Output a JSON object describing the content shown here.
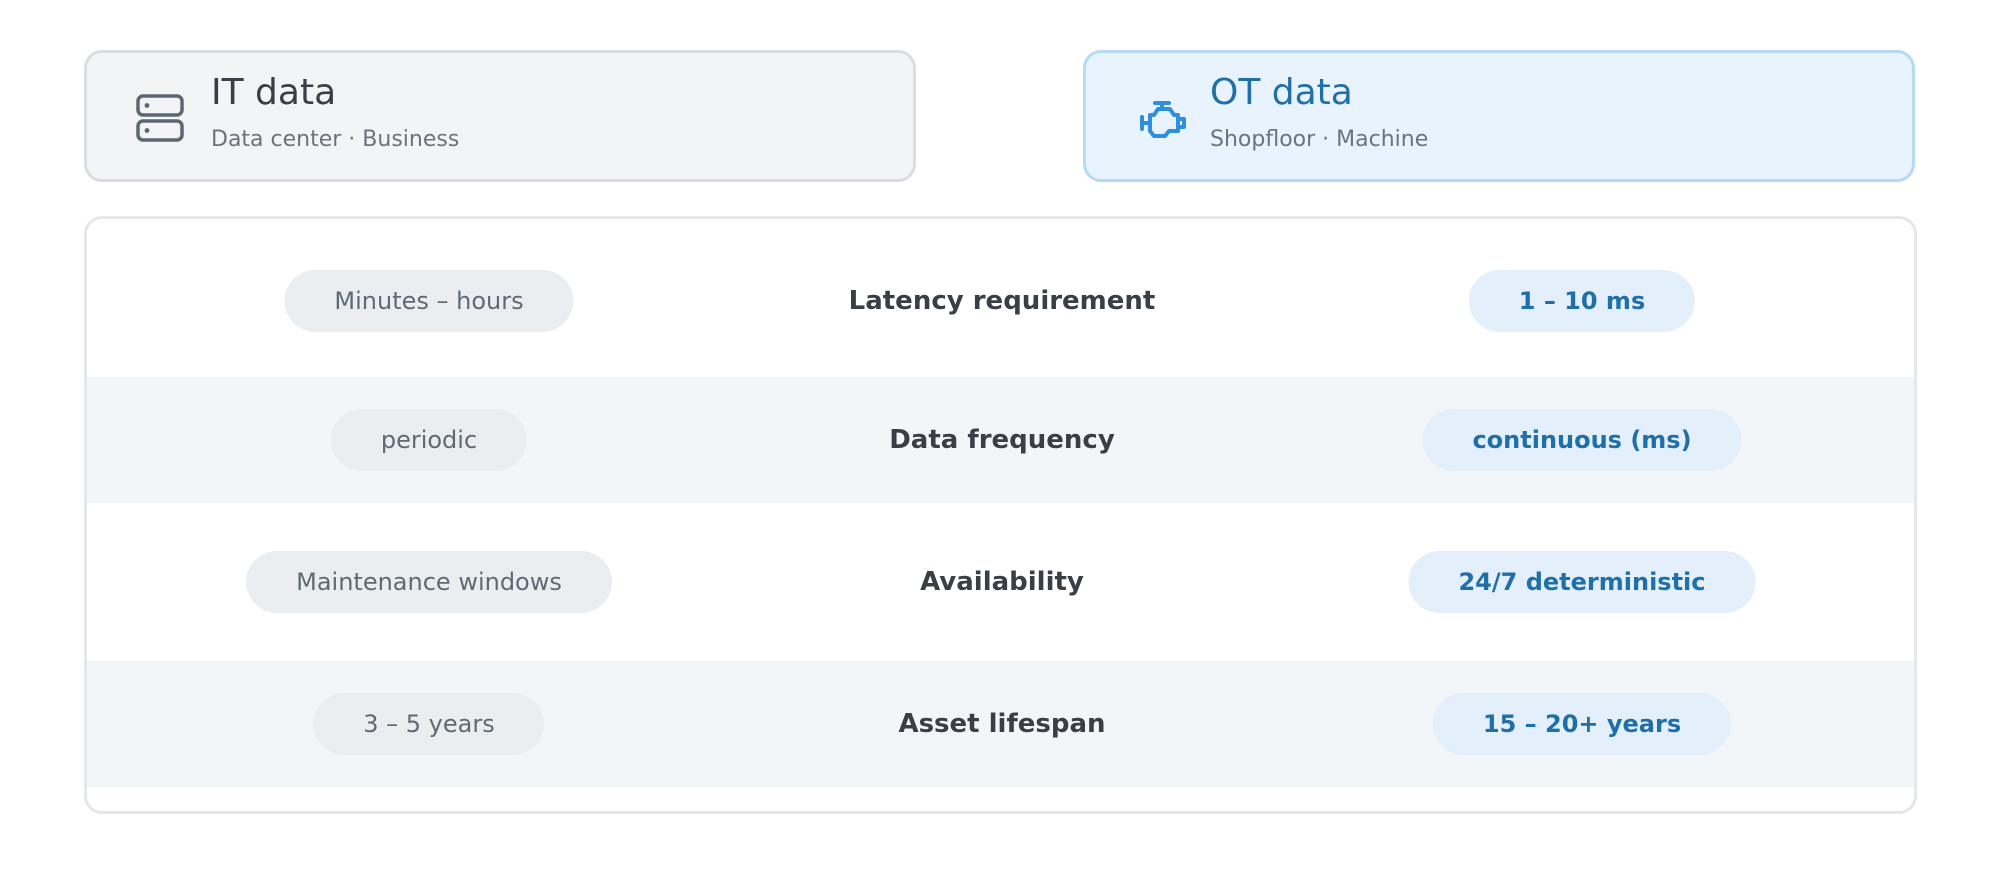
{
  "cards": {
    "it": {
      "title": "IT data",
      "subtitle": "Data center · Business",
      "icon": "server-icon",
      "color": "#5c6773"
    },
    "ot": {
      "title": "OT data",
      "subtitle": "Shopfloor · Machine",
      "icon": "engine-icon",
      "color": "#2e8fe0"
    }
  },
  "rows": [
    {
      "it": "Minutes – hours",
      "label": "Latency requirement",
      "ot": "1 – 10 ms"
    },
    {
      "it": "periodic",
      "label": "Data frequency",
      "ot": "continuous (ms)"
    },
    {
      "it": "Maintenance windows",
      "label": "Availability",
      "ot": "24/7 deterministic"
    },
    {
      "it": "3 – 5 years",
      "label": "Asset lifespan",
      "ot": "15 – 20+ years"
    }
  ],
  "colors": {
    "it_accent": "#5c6773",
    "ot_accent": "#1f6fa8",
    "ot_card_bg": "#e8f3fd",
    "alt_row_bg": "#f3f6f9"
  }
}
